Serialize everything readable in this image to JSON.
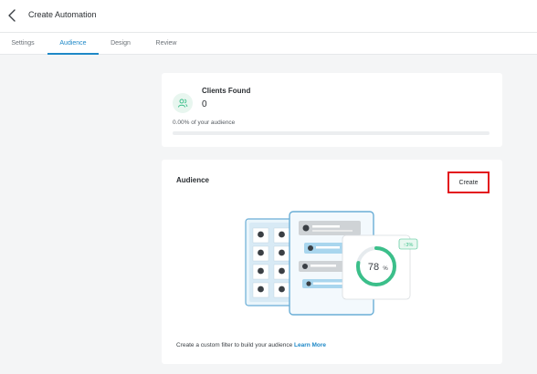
{
  "header": {
    "title": "Create Automation",
    "back_icon": "chevron-left-icon"
  },
  "tabs": [
    {
      "label": "Settings",
      "active": false
    },
    {
      "label": "Audience",
      "active": true
    },
    {
      "label": "Design",
      "active": false
    },
    {
      "label": "Review",
      "active": false
    }
  ],
  "clients": {
    "icon": "users-icon",
    "title": "Clients Found",
    "count": "0",
    "percent_text": "0.00% of your audience",
    "progress_fraction": 0
  },
  "audience": {
    "title": "Audience",
    "create_label": "Create",
    "gauge_value": "78",
    "gauge_unit": "%",
    "gauge_fraction": 0.78,
    "trend_badge": "↑3%",
    "footer_text": "Create a custom filter to build your audience",
    "learn_more": "Learn More"
  },
  "colors": {
    "accent": "#1e88c7",
    "highlight_border": "#e3131b",
    "success": "#3bbf8a"
  }
}
